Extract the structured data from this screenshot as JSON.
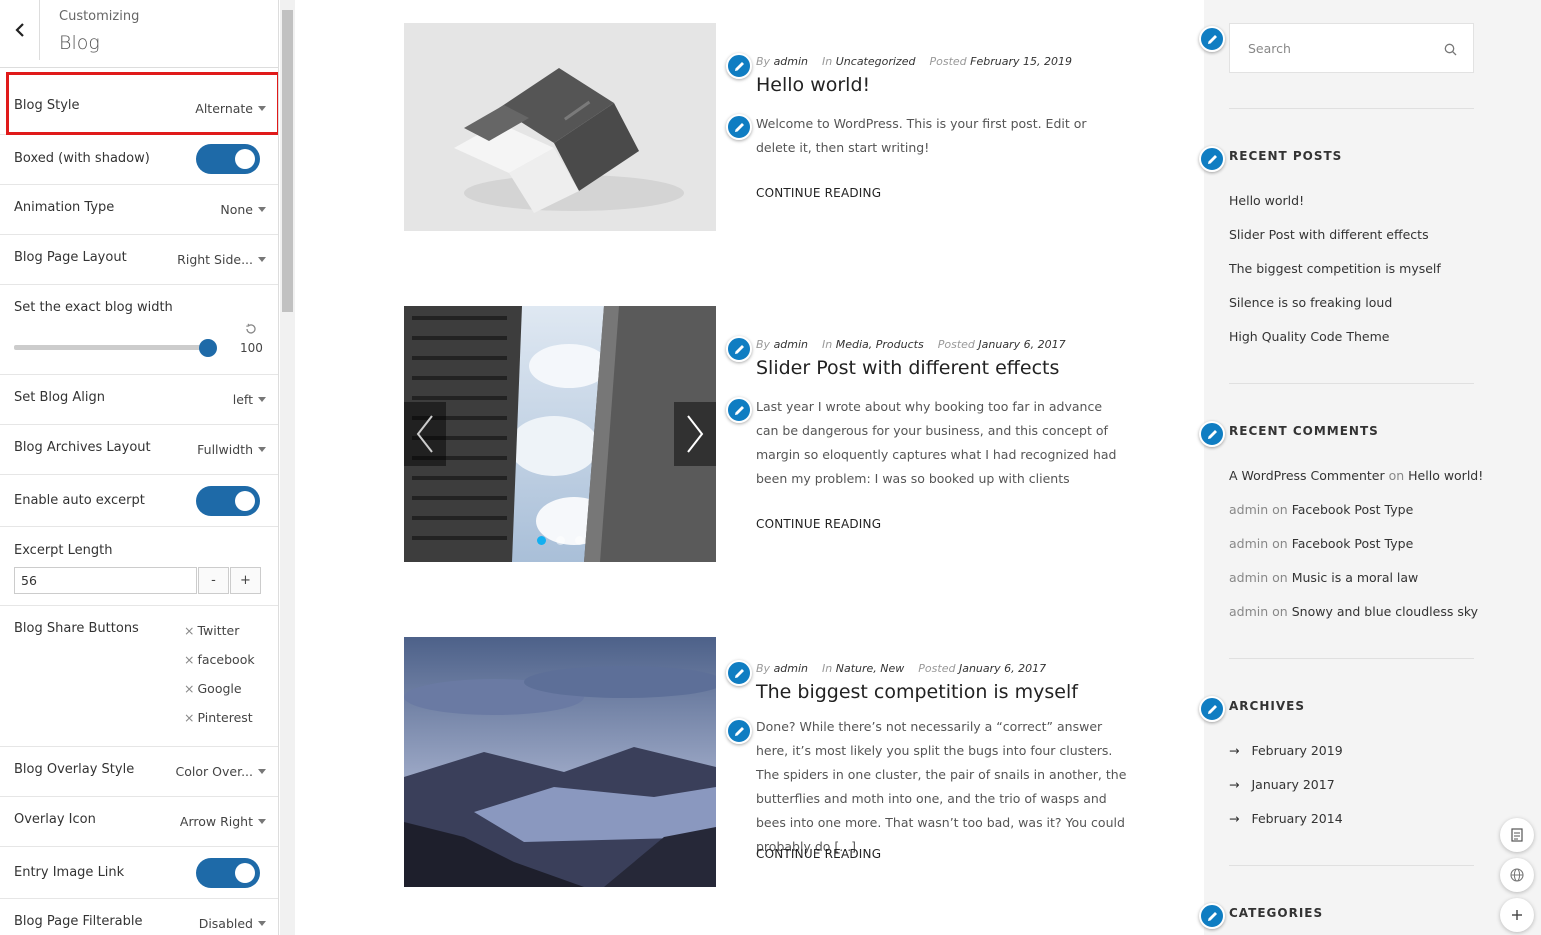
{
  "panel": {
    "subtitle": "Customizing",
    "title": "Blog",
    "controls": {
      "blog_style": {
        "label": "Blog Style",
        "value": "Alternate"
      },
      "boxed": {
        "label": "Boxed (with shadow)",
        "on": true
      },
      "animation": {
        "label": "Animation Type",
        "value": "None"
      },
      "page_layout": {
        "label": "Blog Page Layout",
        "value": "Right Side..."
      },
      "blog_width": {
        "label": "Set the exact blog width",
        "value": "100"
      },
      "blog_align": {
        "label": "Set Blog Align",
        "value": "left"
      },
      "archives_layout": {
        "label": "Blog Archives Layout",
        "value": "Fullwidth"
      },
      "auto_excerpt": {
        "label": "Enable auto excerpt",
        "on": true
      },
      "excerpt_length": {
        "label": "Excerpt Length",
        "value": "56",
        "minus": "-",
        "plus": "+"
      },
      "share_buttons": {
        "label": "Blog Share Buttons",
        "items": [
          "Twitter",
          "facebook",
          "Google",
          "Pinterest"
        ]
      },
      "overlay_style": {
        "label": "Blog Overlay Style",
        "value": "Color Over..."
      },
      "overlay_icon": {
        "label": "Overlay Icon",
        "value": "Arrow Right"
      },
      "entry_image_link": {
        "label": "Entry Image Link",
        "on": true
      },
      "filterable": {
        "label": "Blog Page Filterable",
        "value": "Disabled"
      }
    }
  },
  "posts": [
    {
      "by": "By",
      "author": "admin",
      "in": "In",
      "category": "Uncategorized",
      "posted": "Posted",
      "date": "February 15, 2019",
      "title": "Hello world!",
      "excerpt": "Welcome to WordPress. This is your first post. Edit or delete it, then start writing!",
      "continue": "CONTINUE READING"
    },
    {
      "by": "By",
      "author": "admin",
      "in": "In",
      "category": "Media, Products",
      "posted": "Posted",
      "date": "January 6, 2017",
      "title": "Slider Post with different effects",
      "excerpt": "Last year I wrote about why booking too far in advance can be dangerous for your business, and this concept of margin so eloquently captures what I had recognized had been my problem: I was so booked up with clients",
      "continue": "CONTINUE READING"
    },
    {
      "by": "By",
      "author": "admin",
      "in": "In",
      "category": "Nature, New",
      "posted": "Posted",
      "date": "January 6, 2017",
      "title": "The biggest competition is myself",
      "excerpt": "Done? While there’s not necessarily a “correct” answer here, it’s most likely you split the bugs into four clusters. The spiders in one cluster, the pair of snails in another, the butterflies and moth into one, and the trio of wasps and bees into one more. That wasn’t too bad, was it? You could probably do [...]",
      "continue": "CONTINUE READING"
    }
  ],
  "sidebar": {
    "search_placeholder": "Search",
    "recent_posts": {
      "title": "RECENT POSTS",
      "items": [
        "Hello world!",
        "Slider Post with different effects",
        "The biggest competition is myself",
        "Silence is so freaking loud",
        "High Quality Code Theme"
      ]
    },
    "recent_comments": {
      "title": "RECENT COMMENTS",
      "on": "on",
      "items": [
        {
          "author": "A WordPress Commenter",
          "post": "Hello world!"
        },
        {
          "author": "admin",
          "post": "Facebook Post Type"
        },
        {
          "author": "admin",
          "post": "Facebook Post Type"
        },
        {
          "author": "admin",
          "post": "Music is a moral law"
        },
        {
          "author": "admin",
          "post": "Snowy and blue cloudless sky"
        }
      ]
    },
    "archives": {
      "title": "ARCHIVES",
      "items": [
        "February 2019",
        "January 2017",
        "February 2014"
      ]
    },
    "categories": {
      "title": "CATEGORIES"
    }
  },
  "colors": {
    "accent": "#1e6aa8",
    "edit_dot": "#0f7dc2",
    "highlight": "#e01a1a"
  }
}
